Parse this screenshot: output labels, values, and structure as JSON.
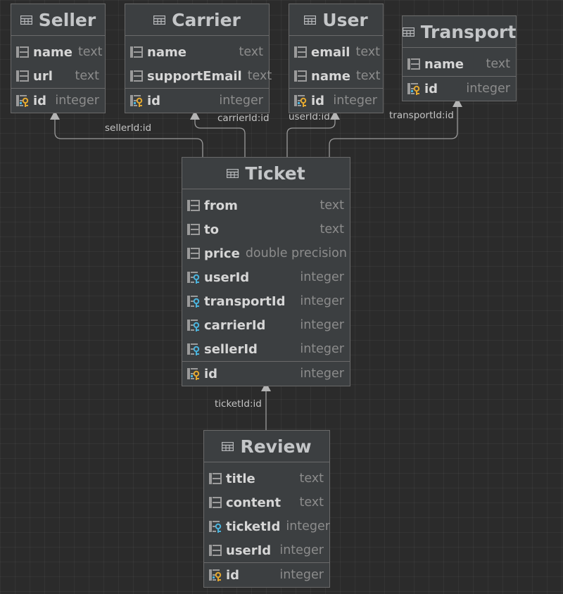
{
  "tables": [
    {
      "name": "Seller",
      "columns": [
        {
          "name": "name",
          "type": "text",
          "kind": "col"
        },
        {
          "name": "url",
          "type": "text",
          "kind": "col"
        }
      ],
      "pk": {
        "name": "id",
        "type": "integer"
      }
    },
    {
      "name": "Carrier",
      "columns": [
        {
          "name": "name",
          "type": "text",
          "kind": "col"
        },
        {
          "name": "supportEmail",
          "type": "text",
          "kind": "col"
        }
      ],
      "pk": {
        "name": "id",
        "type": "integer"
      }
    },
    {
      "name": "User",
      "columns": [
        {
          "name": "email",
          "type": "text",
          "kind": "col"
        },
        {
          "name": "name",
          "type": "text",
          "kind": "col"
        }
      ],
      "pk": {
        "name": "id",
        "type": "integer"
      }
    },
    {
      "name": "Transport",
      "columns": [
        {
          "name": "name",
          "type": "text",
          "kind": "col"
        }
      ],
      "pk": {
        "name": "id",
        "type": "integer"
      }
    },
    {
      "name": "Ticket",
      "columns": [
        {
          "name": "from",
          "type": "text",
          "kind": "col"
        },
        {
          "name": "to",
          "type": "text",
          "kind": "col"
        },
        {
          "name": "price",
          "type": "double precision",
          "kind": "col"
        },
        {
          "name": "userId",
          "type": "integer",
          "kind": "fk"
        },
        {
          "name": "transportId",
          "type": "integer",
          "kind": "fk"
        },
        {
          "name": "carrierId",
          "type": "integer",
          "kind": "fk"
        },
        {
          "name": "sellerId",
          "type": "integer",
          "kind": "fk"
        }
      ],
      "pk": {
        "name": "id",
        "type": "integer"
      }
    },
    {
      "name": "Review",
      "columns": [
        {
          "name": "title",
          "type": "text",
          "kind": "col"
        },
        {
          "name": "content",
          "type": "text",
          "kind": "col"
        },
        {
          "name": "ticketId",
          "type": "integer",
          "kind": "fk"
        },
        {
          "name": "userId",
          "type": "integer",
          "kind": "col"
        }
      ],
      "pk": {
        "name": "id",
        "type": "integer"
      }
    }
  ],
  "relations": [
    {
      "label": "sellerId:id",
      "from": "Ticket",
      "to": "Seller"
    },
    {
      "label": "carrierId:id",
      "from": "Ticket",
      "to": "Carrier"
    },
    {
      "label": "userId:id",
      "from": "Ticket",
      "to": "User"
    },
    {
      "label": "transportId:id",
      "from": "Ticket",
      "to": "Transport"
    },
    {
      "label": "ticketId:id",
      "from": "Review",
      "to": "Ticket"
    }
  ],
  "colors": {
    "background": "#2b2b2b",
    "table_bg": "#3c3f41",
    "border": "#6a6a6a",
    "icon_blue": "#4ab3dc",
    "key_gold": "#e3a82f"
  }
}
